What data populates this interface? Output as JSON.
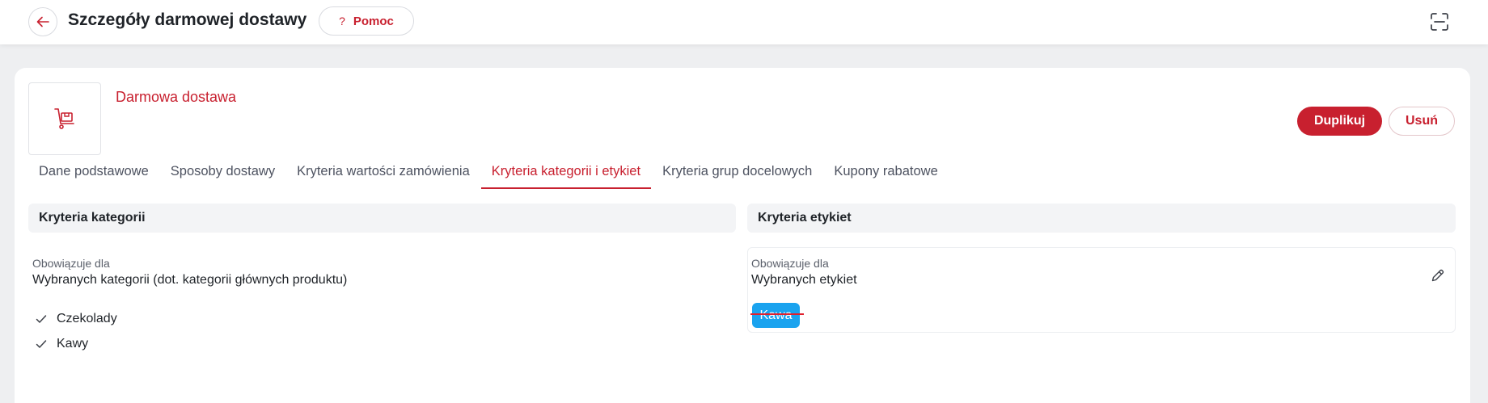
{
  "header": {
    "title": "Szczegóły darmowej dostawy",
    "help_label": "Pomoc",
    "help_icon": "?"
  },
  "promo": {
    "name": "Darmowa dostawa",
    "duplicate_label": "Duplikuj",
    "delete_label": "Usuń"
  },
  "tabs": [
    {
      "label": "Dane podstawowe",
      "active": false
    },
    {
      "label": "Sposoby dostawy",
      "active": false
    },
    {
      "label": "Kryteria wartości zamówienia",
      "active": false
    },
    {
      "label": "Kryteria kategorii i etykiet",
      "active": true
    },
    {
      "label": "Kryteria grup docelowych",
      "active": false
    },
    {
      "label": "Kupony rabatowe",
      "active": false
    }
  ],
  "categories": {
    "title": "Kryteria kategorii",
    "applies_label": "Obowiązuje dla",
    "applies_value": "Wybranych kategorii (dot. kategorii głównych produktu)",
    "items": [
      "Czekolady",
      "Kawy"
    ]
  },
  "labels": {
    "title": "Kryteria etykiet",
    "applies_label": "Obowiązuje dla",
    "applies_value": "Wybranych etykiet",
    "tags": [
      "Kawa"
    ]
  },
  "colors": {
    "accent": "#c8202f",
    "tag": "#1aa3ef",
    "section_bg": "#f3f4f6"
  }
}
